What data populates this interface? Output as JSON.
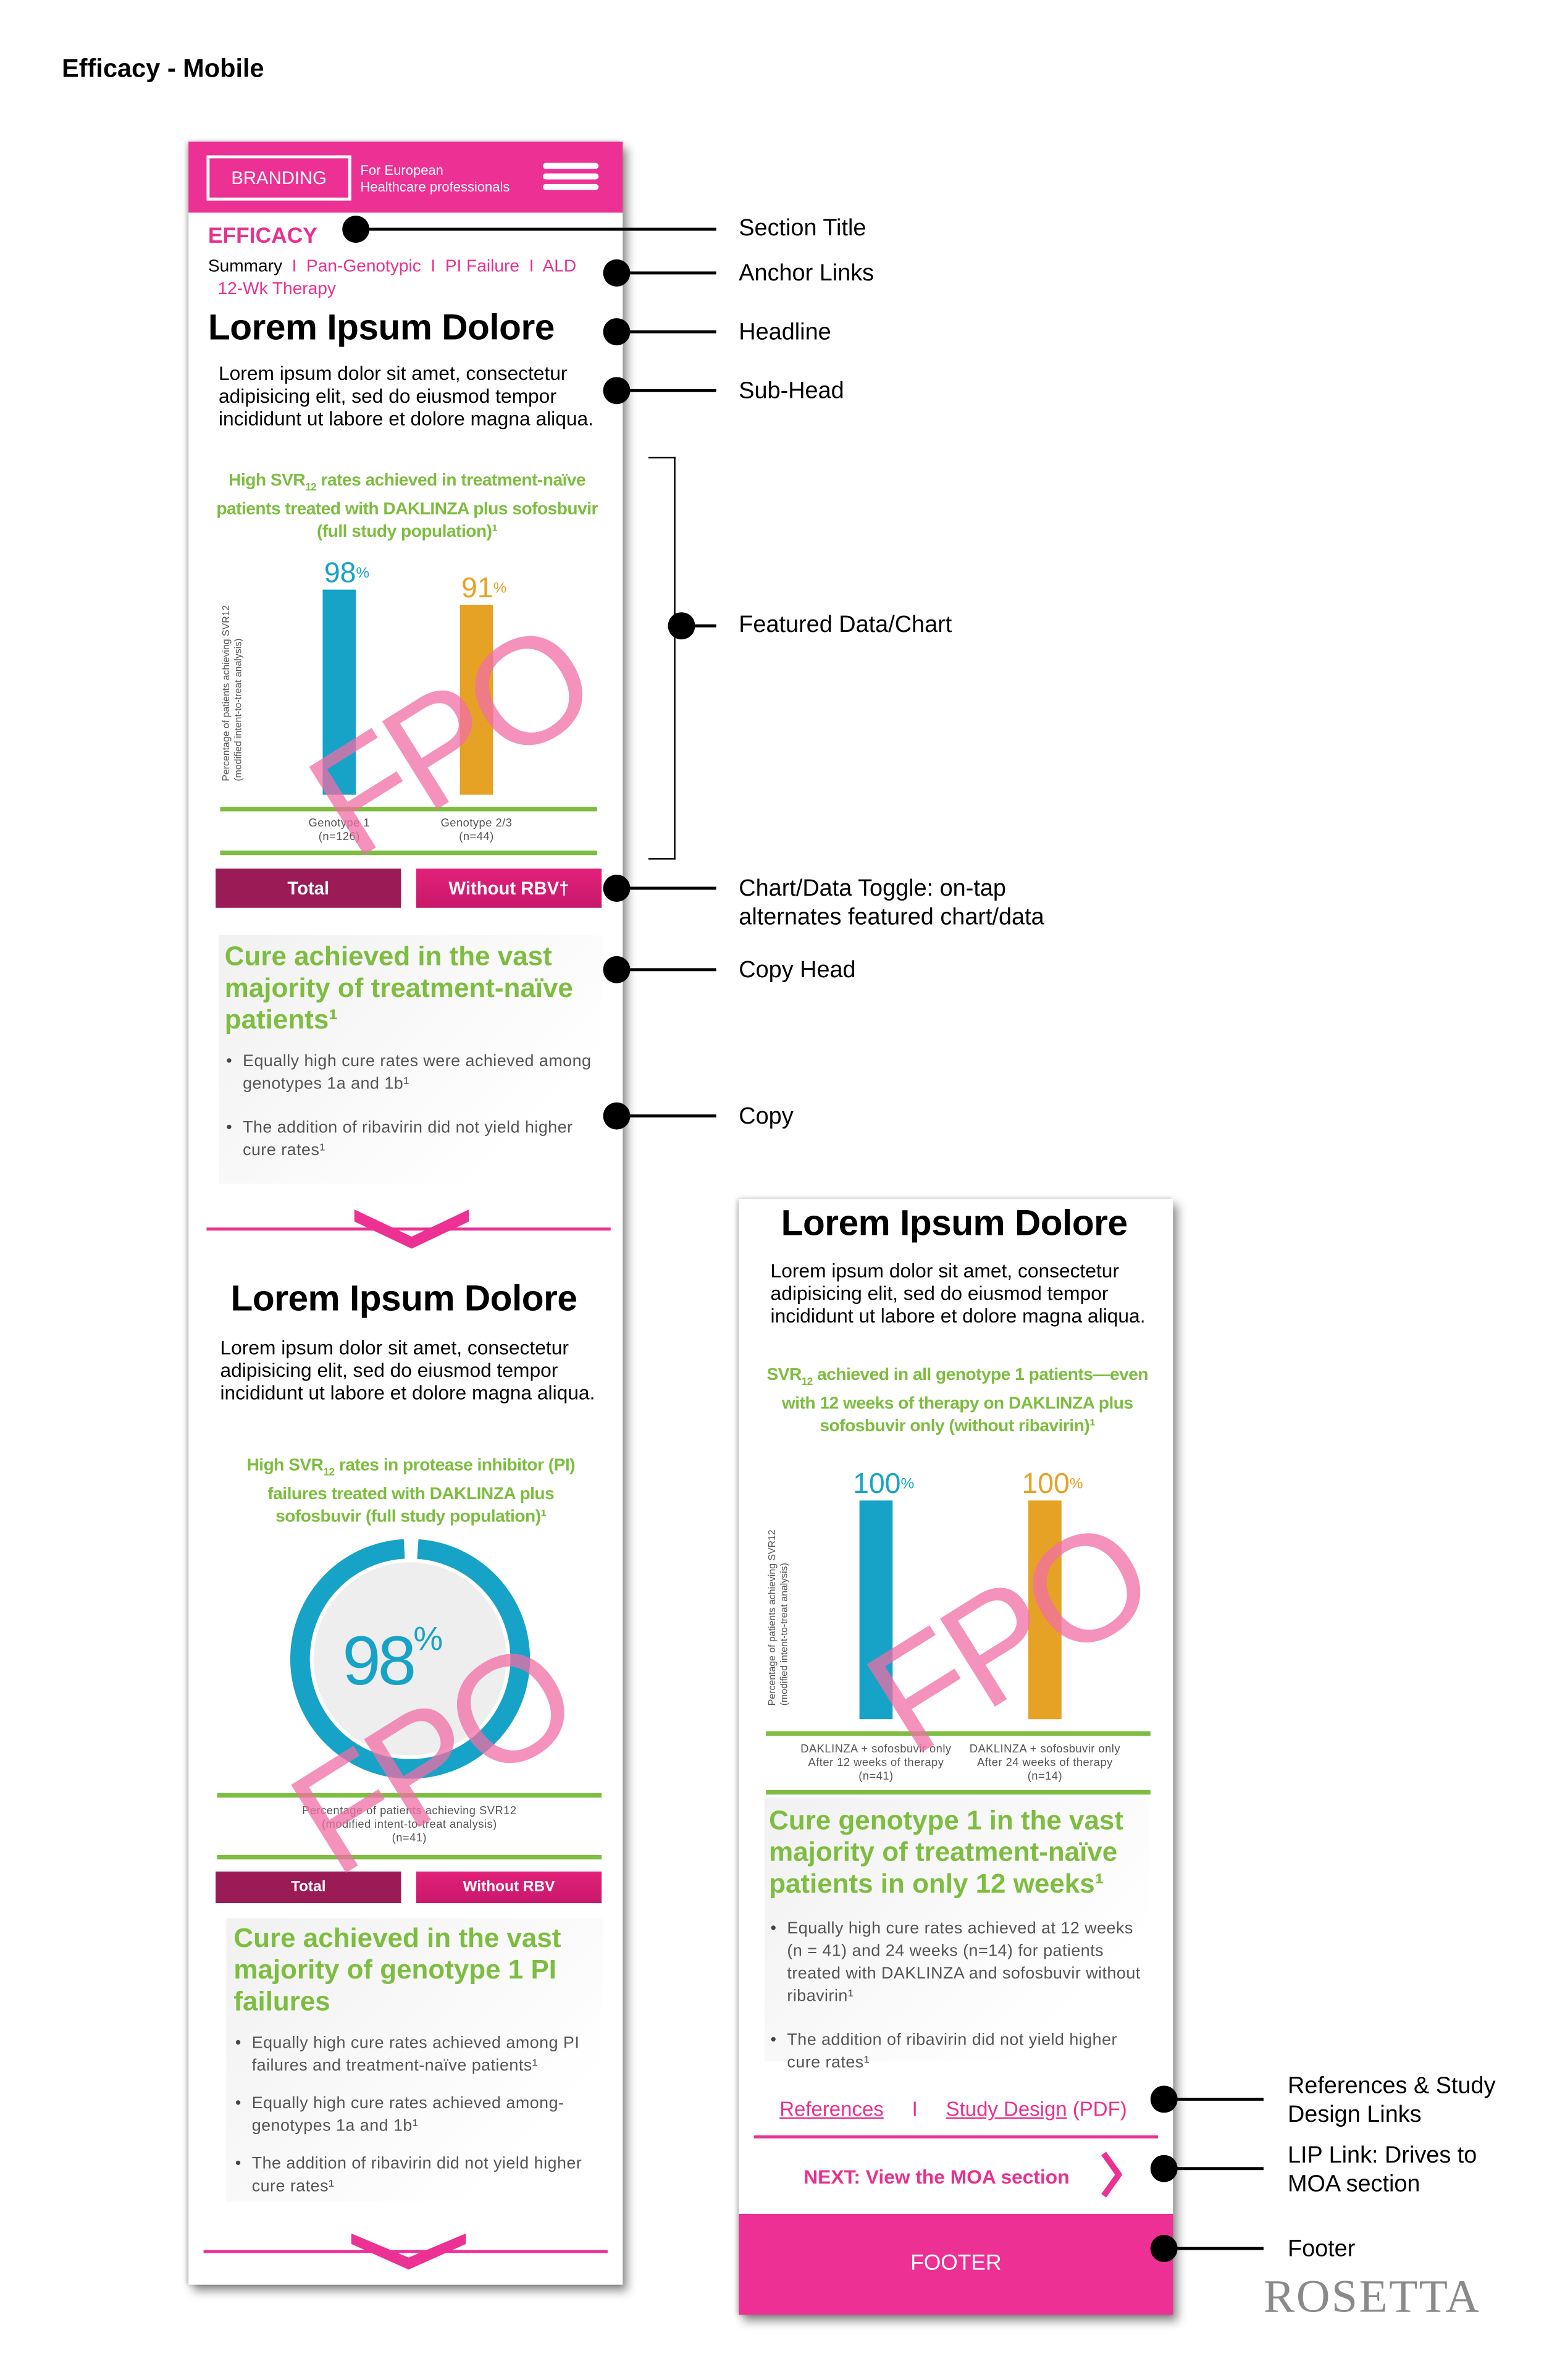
{
  "page_title": "Efficacy - Mobile",
  "colors": {
    "brand_pink": "#ec3094",
    "green": "#7dbd3f",
    "blue": "#17a3c8",
    "orange": "#e6a224",
    "toggle_dark": "#9b1b56"
  },
  "header": {
    "branding": "BRANDING",
    "hcp_line1": "For European",
    "hcp_line2": "Healthcare professionals",
    "menu_icon": "hamburger-icon"
  },
  "left": {
    "section_title": "EFFICACY",
    "anchors": [
      "Summary",
      "Pan-Genotypic",
      "PI Failure",
      "ALD",
      "12-Wk Therapy"
    ],
    "separator": "I",
    "s1": {
      "headline": "Lorem Ipsum Dolore",
      "subhead": "Lorem ipsum dolor sit amet, consectetur adipisicing elit, sed do eiusmod tempor incididunt ut labore et dolore magna aliqua.",
      "chart_title_pre": "High SVR",
      "chart_title_sub": "12",
      "chart_title_post": " rates achieved in treatment-naïve patients treated with DAKLINZA plus sofosbuvir (full study population)¹",
      "toggle": [
        "Total",
        "Without RBV†"
      ],
      "copy_head": "Cure achieved in the vast majority of treatment-naïve patients¹",
      "bullets": [
        "Equally high cure rates were achieved among genotypes 1a and 1b¹",
        "The addition of ribavirin did not yield higher cure rates¹"
      ]
    },
    "s2": {
      "headline": "Lorem Ipsum Dolore",
      "subhead": "Lorem ipsum dolor sit amet, consectetur adipisicing elit, sed do eiusmod tempor incididunt ut labore et dolore magna aliqua.",
      "chart_title_pre": "High SVR",
      "chart_title_sub": "12",
      "chart_title_post": " rates in protease inhibitor (PI) failures treated with DAKLINZA plus sofosbuvir (full study population)¹",
      "toggle": [
        "Total",
        "Without RBV"
      ],
      "copy_head": "Cure achieved in the vast majority of genotype 1 PI failures",
      "bullets": [
        "Equally high cure rates achieved among PI failures and treatment-naïve patients¹",
        "Equally high cure rates achieved among-genotypes 1a and 1b¹",
        "The addition of ribavirin did not yield higher cure rates¹"
      ]
    }
  },
  "right": {
    "headline": "Lorem Ipsum Dolore",
    "subhead": "Lorem ipsum dolor sit amet, consectetur adipisicing elit, sed do eiusmod tempor incididunt ut labore et dolore magna aliqua.",
    "chart_title_pre": "SVR",
    "chart_title_sub": "12",
    "chart_title_post": " achieved in all genotype 1 patients—even with 12 weeks of therapy on DAKLINZA plus sofosbuvir only (without ribavirin)¹",
    "copy_head": "Cure genotype 1 in the vast majority of treatment-naïve patients in only 12 weeks¹",
    "bullets": [
      "Equally high cure rates achieved at 12 weeks (n = 41) and 24 weeks (n=14) for patients treated with DAKLINZA and sofosbuvir without ribavirin¹",
      "The addition of ribavirin did not yield higher cure rates¹"
    ],
    "links": {
      "references": "References",
      "sep": "I",
      "study_design": "Study Design",
      "pdf": "(PDF)"
    },
    "next": "NEXT: View the MOA section",
    "footer": "FOOTER"
  },
  "fpo": "FPO",
  "annotations": [
    "Section Title",
    "Anchor Links",
    "Headline",
    "Sub-Head",
    "Featured Data/Chart",
    "Chart/Data Toggle: on-tap alternates featured chart/data",
    "Copy Head",
    "Copy",
    "References & Study Design Links",
    "LIP Link: Drives to MOA section",
    "Footer"
  ],
  "logo": "ROSETTA",
  "chart_data": [
    {
      "type": "bar",
      "ylabel": "Percentage of patients achieving SVR12 (modified intent-to-treat analysis)",
      "ylim": [
        0,
        100
      ],
      "categories": [
        "Genotype 1 (n=126)",
        "Genotype 2/3 (n=44)"
      ],
      "cat_lines": [
        [
          "Genotype 1",
          "(n=126)"
        ],
        [
          "Genotype 2/3",
          "(n=44)"
        ]
      ],
      "values": [
        98,
        91
      ],
      "labels": [
        "98",
        "91"
      ],
      "unit": "%",
      "colors": [
        "#17a3c8",
        "#e6a224"
      ]
    },
    {
      "type": "pie",
      "variant": "donut",
      "value": 98,
      "label": "98",
      "unit": "%",
      "caption": [
        "Percentage of patients achieving SVR12",
        "(modified intent-to-treat analysis)",
        "(n=41)"
      ],
      "color": "#17a3c8"
    },
    {
      "type": "bar",
      "ylabel": "Percentage of patients achieving SVR12 (modified intent-to-treat analysis)",
      "ylim": [
        0,
        100
      ],
      "categories": [
        "DAKLINZA + sofosbuvir only After 12 weeks of therapy (n=41)",
        "DAKLINZA + sofosbuvir only After 24 weeks of therapy (n=14)"
      ],
      "cat_lines": [
        [
          "DAKLINZA + sofosbuvir only",
          "After 12 weeks of therapy",
          "(n=41)"
        ],
        [
          "DAKLINZA + sofosbuvir only",
          "After 24 weeks of therapy",
          "(n=14)"
        ]
      ],
      "values": [
        100,
        100
      ],
      "labels": [
        "100",
        "100"
      ],
      "unit": "%",
      "colors": [
        "#17a3c8",
        "#e6a224"
      ]
    }
  ]
}
